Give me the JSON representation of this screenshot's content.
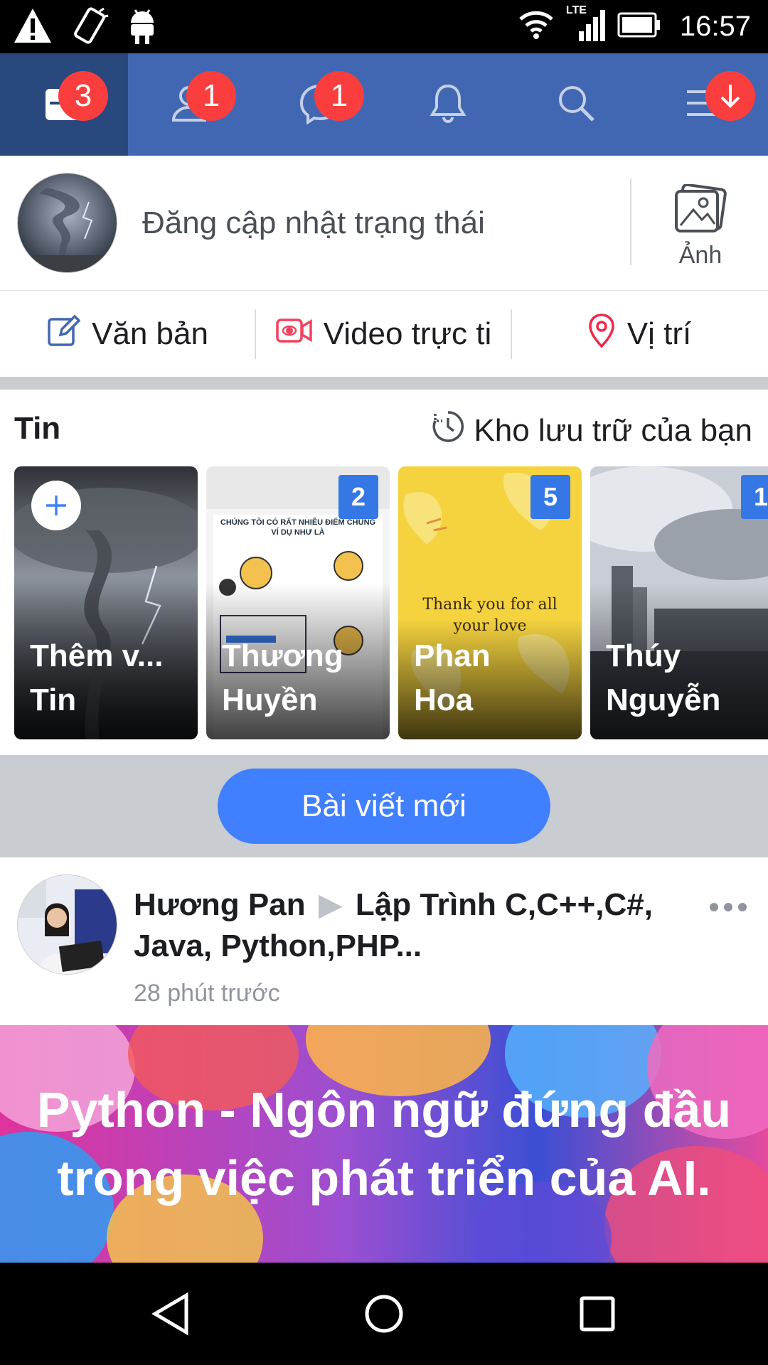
{
  "status_bar": {
    "time": "16:57",
    "network": "LTE"
  },
  "topnav": {
    "tabs": [
      {
        "name": "news-feed",
        "badge": "3",
        "active": true
      },
      {
        "name": "friend-requests",
        "badge": "1"
      },
      {
        "name": "messages",
        "badge": "1"
      },
      {
        "name": "notifications",
        "badge": ""
      },
      {
        "name": "search",
        "badge": ""
      },
      {
        "name": "menu",
        "badge": "↓"
      }
    ]
  },
  "composer": {
    "placeholder": "Đăng cập nhật trạng thái",
    "photo_label": "Ảnh"
  },
  "actions": {
    "text": "Văn bản",
    "live_video": "Video trực ti",
    "location": "Vị trí"
  },
  "stories": {
    "title": "Tin",
    "archive": "Kho lưu trữ của bạn",
    "items": [
      {
        "name": "Thêm v...\nTin",
        "count": ""
      },
      {
        "name": "Thương\nHuyền",
        "count": "2"
      },
      {
        "name": "Phan\nHoa",
        "count": "5"
      },
      {
        "name": "Thúy\nNguyễn",
        "count": "1"
      }
    ],
    "story_texts": {
      "huyen_header": "CHÚNG TÔI CÓ RẤT NHIỀU ĐIỂM CHUNG\nVÍ DỤ NHƯ LÀ",
      "hoa_text": "Thank you for all\nyour love"
    }
  },
  "new_posts": {
    "label": "Bài viết mới"
  },
  "post": {
    "author": "Hương Pan",
    "group": "Lập Trình C,C++,C#, Java, Python,PHP...",
    "time": "28 phút trước",
    "banner_text": "Python - Ngôn ngữ đứng đầu trong việc phát triển của AI."
  },
  "colors": {
    "brand": "#4267b2",
    "brand_dark": "#29487d",
    "badge": "#fa3e3e",
    "pill": "#4080ff",
    "count": "#3578e5"
  }
}
